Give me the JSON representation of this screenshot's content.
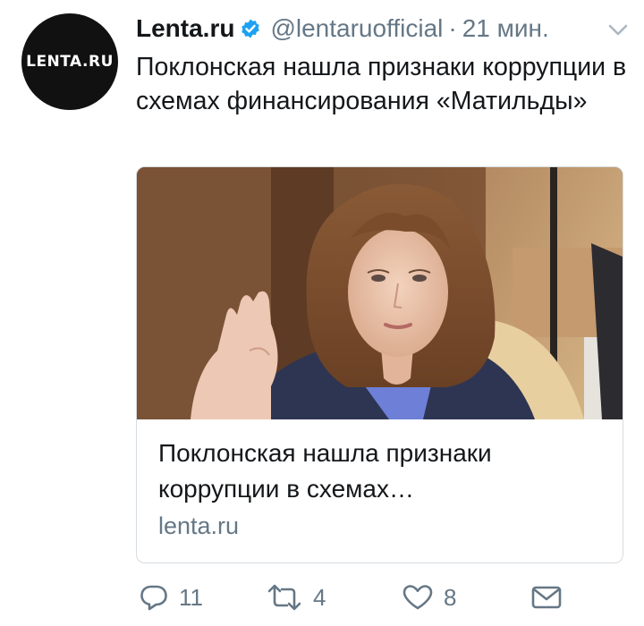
{
  "tweet": {
    "avatar_text": "LENTA.RU",
    "author_name": "Lenta.ru",
    "handle": "@lentaruofficial",
    "separator": "·",
    "time": "21 мин.",
    "text": "Поклонская нашла признаки коррупции в схемах финансирования «Матильды»"
  },
  "card": {
    "title": "Поклонская нашла признаки коррупции в схемах…",
    "domain": "lenta.ru"
  },
  "actions": {
    "reply_count": "11",
    "retweet_count": "4",
    "like_count": "8"
  },
  "colors": {
    "accent": "#1da1f2",
    "secondary_text": "#657786",
    "primary_text": "#14171a"
  },
  "icons": [
    "verified-badge-icon",
    "chevron-down-icon",
    "reply-icon",
    "retweet-icon",
    "like-icon",
    "direct-message-icon"
  ]
}
